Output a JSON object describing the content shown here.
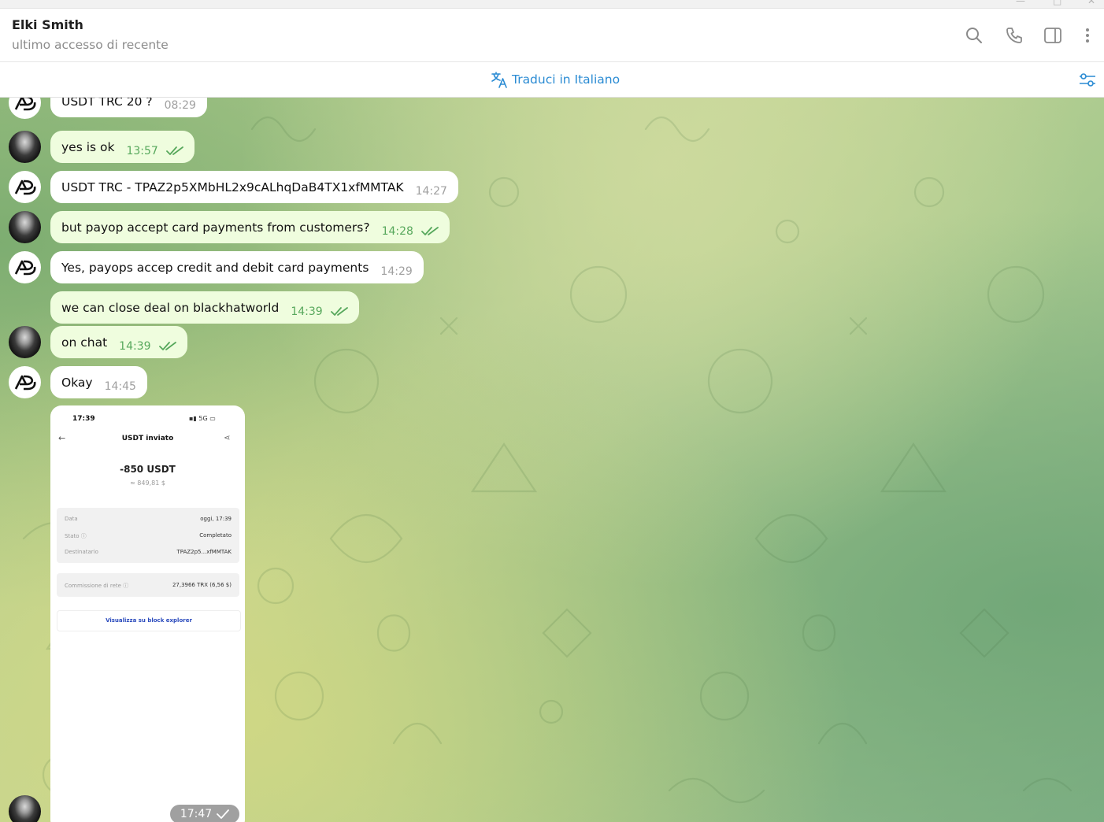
{
  "header": {
    "name": "Elki Smith",
    "status": "ultimo accesso di recente"
  },
  "translate": {
    "label": "Traduci in Italiano"
  },
  "messages": [
    {
      "side": "in",
      "text": "USDT TRC 20 ?",
      "time": "08:29"
    },
    {
      "side": "out",
      "text": "yes is ok",
      "time": "13:57"
    },
    {
      "side": "in",
      "text": "USDT TRC  - TPAZ2p5XMbHL2x9cALhqDaB4TX1xfMMTAK",
      "time": "14:27"
    },
    {
      "side": "out",
      "text": "but payop accept card payments from customers?",
      "time": "14:28"
    },
    {
      "side": "in",
      "text": "Yes, payops accep credit and debit card payments",
      "time": "14:29"
    },
    {
      "side": "out",
      "text": "we can close deal on blackhatworld",
      "time": "14:39"
    },
    {
      "side": "out",
      "text": "on chat",
      "time": "14:39"
    },
    {
      "side": "in",
      "text": "Okay",
      "time": "14:45"
    }
  ],
  "photo_message": {
    "time": "17:47",
    "screenshot": {
      "status_time": "17:39",
      "network": "5G",
      "title": "USDT inviato",
      "amount": "-850 USDT",
      "fiat": "≈ 849,81 $",
      "rows": [
        {
          "label": "Data",
          "value": "oggi, 17:39"
        },
        {
          "label": "Stato",
          "value": "Completato"
        },
        {
          "label": "Destinatario",
          "value": "TPAZ2p5...xfMMTAK"
        }
      ],
      "fee_label": "Commissione di rete",
      "fee_value": "27,3966 TRX (6,56 $)",
      "explorer_link": "Visualizza su block explorer"
    }
  },
  "colors": {
    "accent": "#2a8bd3",
    "outgoing_bubble": "#effdde",
    "outgoing_time": "#57a85c",
    "incoming_bubble": "#ffffff"
  },
  "icons": [
    "search-icon",
    "phone-icon",
    "sidebar-toggle-icon",
    "more-vertical-icon",
    "translate-icon",
    "filter-settings-icon",
    "double-check-icon"
  ]
}
